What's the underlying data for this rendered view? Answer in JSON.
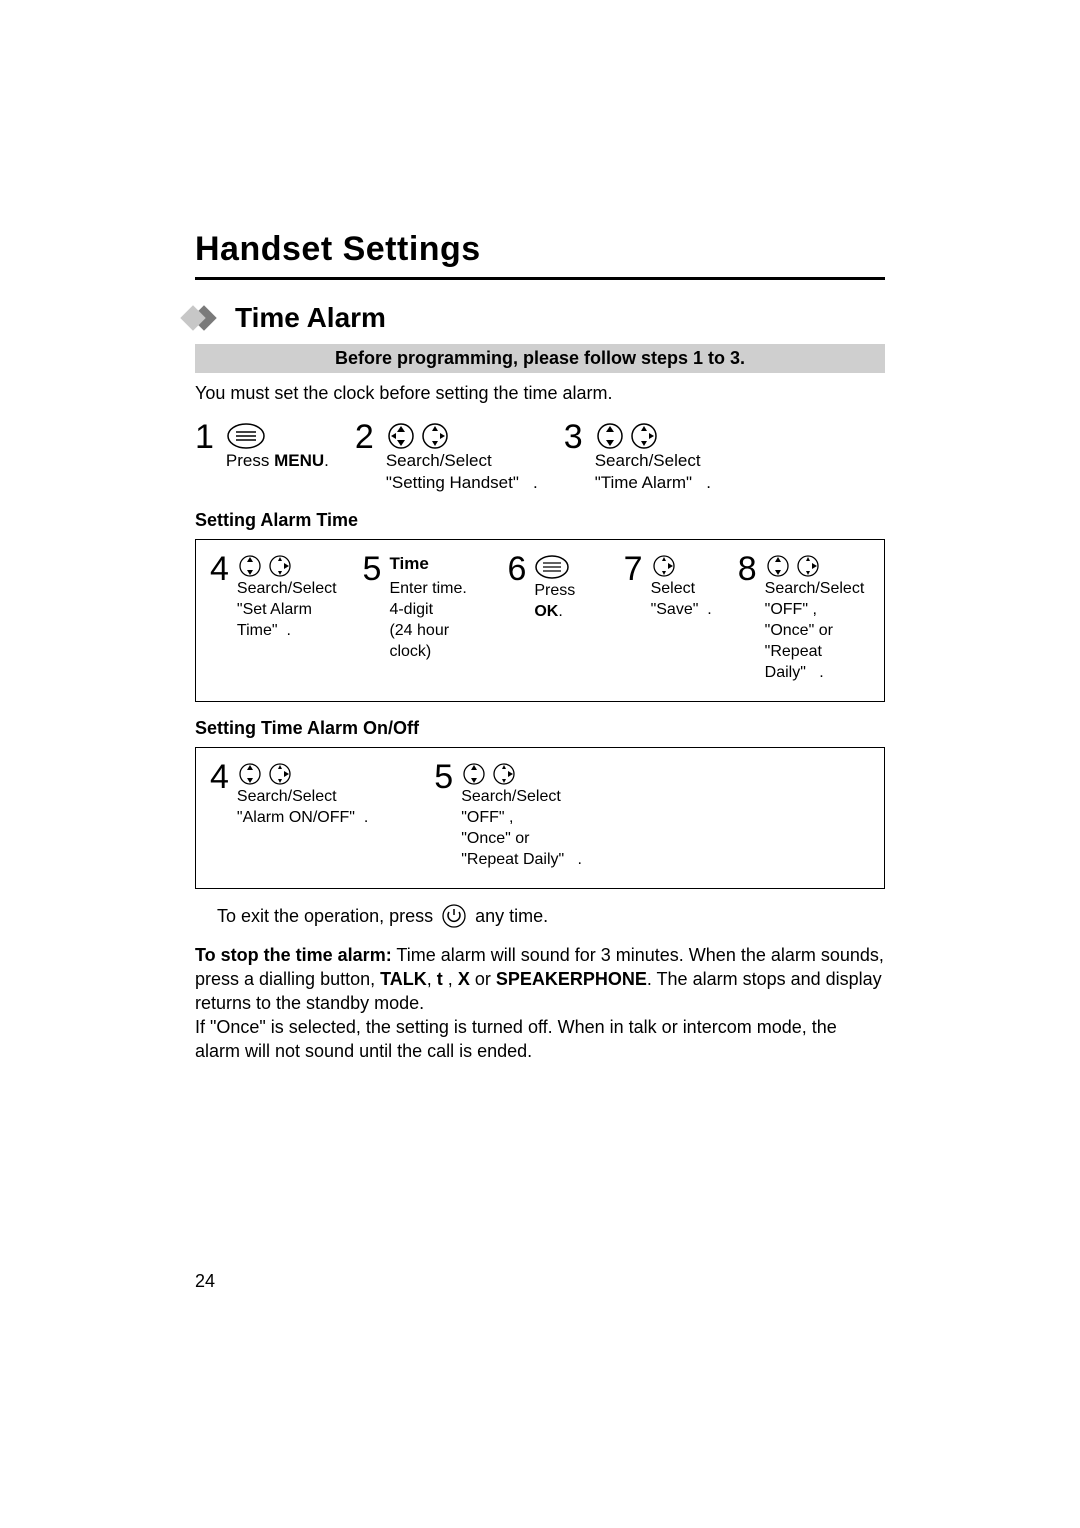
{
  "title": "Handset Settings",
  "section": "Time Alarm",
  "banner": "Before programming, please follow steps 1 to 3.",
  "intro": "You must set the clock before setting the time alarm.",
  "steps_main": {
    "s1": "Press ",
    "s1b": "MENU",
    "s1c": ".",
    "s2a": "Search/Select",
    "s2b": "\"Setting Handset\"",
    "s3a": "Search/Select",
    "s3b": "\"Time Alarm\""
  },
  "head_set_alarm_time": "Setting Alarm Time",
  "box1": {
    "s4a": "Search/Select",
    "s4b": "\"Set Alarm",
    "s4c": "Time\"",
    "s5title": "Time",
    "s5a": "Enter time.",
    "s5b": "4-digit",
    "s5c": "(24 hour clock)",
    "s6a": "Press ",
    "s6b": "OK",
    "s6c": ".",
    "s7a": "Select",
    "s7b": "\"Save\"",
    "s8a": "Search/Select",
    "s8b": "\"OFF\" ,",
    "s8c": "\"Once\"  or",
    "s8d": "\"Repeat Daily\""
  },
  "head_onoff": "Setting Time Alarm On/Off",
  "box2": {
    "s4a": "Search/Select",
    "s4b": "\"Alarm ON/OFF\"",
    "s5a": "Search/Select",
    "s5b": "\"OFF\" ,",
    "s5c": "\"Once\"  or",
    "s5d": "\"Repeat Daily\""
  },
  "exit": "To exit the operation, press ",
  "exit2": " any time.",
  "note1a": "To stop the time alarm:",
  "note1b": " Time alarm will sound for 3 minutes. When the alarm sounds, press a dialling button, ",
  "note1c": "TALK",
  "note1d": ", ",
  "note1dd": "t",
  "note1e": " , ",
  "note1ee": "X",
  "note1f": " or ",
  "note1g": "SPEAKERPHONE",
  "note1h": ". The alarm stops and display returns to the standby mode.",
  "note2": "If \"Once\"  is selected, the setting is turned off. When in talk or intercom mode, the alarm will not sound until the call is ended.",
  "page_number": "24"
}
